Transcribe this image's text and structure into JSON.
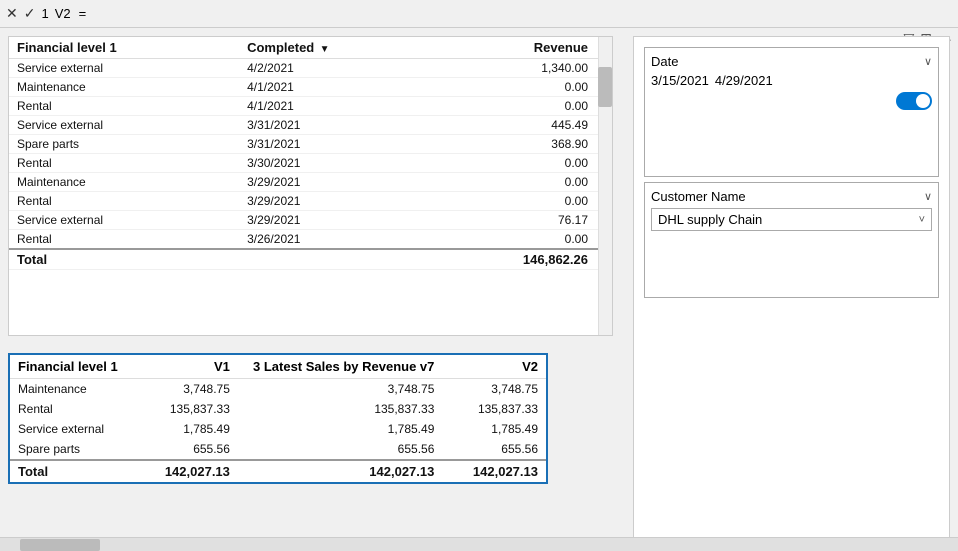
{
  "toolbar": {
    "close_label": "✕",
    "check_label": "✓",
    "cell_ref": "1",
    "v2_label": "V2",
    "equals_label": "="
  },
  "top_table": {
    "headers": [
      "Financial level 1",
      "Completed",
      "Revenue"
    ],
    "sort_indicator": "▼",
    "rows": [
      {
        "level": "Service external",
        "completed": "4/2/2021",
        "revenue": "1,340.00"
      },
      {
        "level": "Maintenance",
        "completed": "4/1/2021",
        "revenue": "0.00"
      },
      {
        "level": "Rental",
        "completed": "4/1/2021",
        "revenue": "0.00"
      },
      {
        "level": "Service external",
        "completed": "3/31/2021",
        "revenue": "445.49"
      },
      {
        "level": "Spare parts",
        "completed": "3/31/2021",
        "revenue": "368.90"
      },
      {
        "level": "Rental",
        "completed": "3/30/2021",
        "revenue": "0.00"
      },
      {
        "level": "Maintenance",
        "completed": "3/29/2021",
        "revenue": "0.00"
      },
      {
        "level": "Rental",
        "completed": "3/29/2021",
        "revenue": "0.00"
      },
      {
        "level": "Service external",
        "completed": "3/29/2021",
        "revenue": "76.17"
      },
      {
        "level": "Rental",
        "completed": "3/26/2021",
        "revenue": "0.00"
      }
    ],
    "total_label": "Total",
    "total_value": "146,862.26"
  },
  "bottom_table": {
    "headers": [
      "Financial level 1",
      "V1",
      "",
      "3 Latest Sales by Revenue v7",
      "",
      "V2"
    ],
    "col1_label": "Financial level 1",
    "col2_label": "V1",
    "col3_label": "3 Latest Sales by Revenue v7",
    "col4_label": "V2",
    "rows": [
      {
        "level": "Maintenance",
        "v1": "3,748.75",
        "mid": "3,748.75",
        "v2": "3,748.75"
      },
      {
        "level": "Rental",
        "v1": "135,837.33",
        "mid": "135,837.33",
        "v2": "135,837.33"
      },
      {
        "level": "Service external",
        "v1": "1,785.49",
        "mid": "1,785.49",
        "v2": "1,785.49"
      },
      {
        "level": "Spare parts",
        "v1": "655.56",
        "mid": "655.56",
        "v2": "655.56"
      }
    ],
    "total_label": "Total",
    "total_v1": "142,027.13",
    "total_mid": "142,027.13",
    "total_v2": "142,027.13"
  },
  "date_filter": {
    "label": "Date",
    "from": "3/15/2021",
    "to": "4/29/2021"
  },
  "customer_filter": {
    "label": "Customer Name",
    "selected": "DHL supply Chain"
  },
  "icons": {
    "filter": "▽",
    "grid": "⊞",
    "more": "···",
    "chevron_down": "∨",
    "chevron_down2": "˅"
  }
}
